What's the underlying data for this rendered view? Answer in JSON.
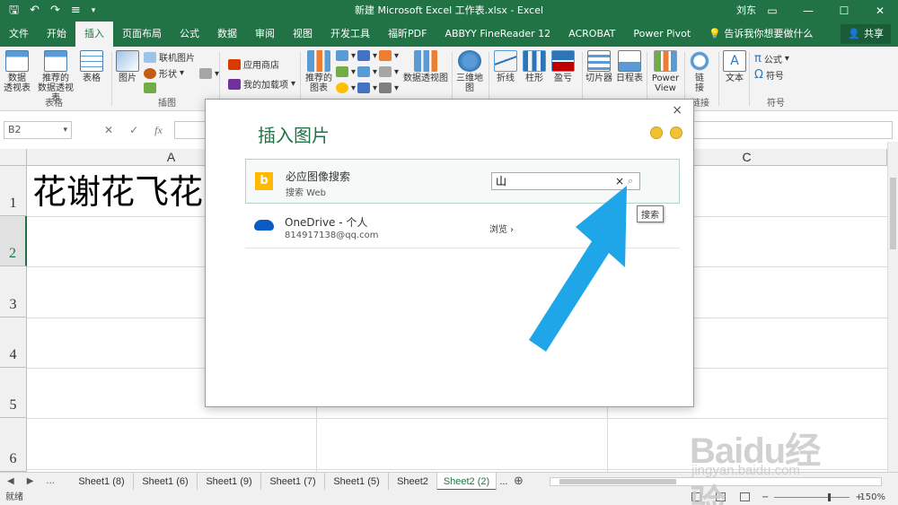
{
  "window": {
    "title": "新建 Microsoft Excel 工作表.xlsx  -  Excel",
    "user": "刘东",
    "qat_icons": [
      "save-icon",
      "undo-icon",
      "redo-icon",
      "customize-icon"
    ]
  },
  "tabs": [
    "文件",
    "开始",
    "插入",
    "页面布局",
    "公式",
    "数据",
    "审阅",
    "视图",
    "开发工具",
    "福昕PDF",
    "ABBYY FineReader 12",
    "ACROBAT",
    "Power Pivot",
    "告诉我你想要做什么"
  ],
  "active_tab": "插入",
  "share": "共享",
  "ribbon": {
    "pivot": "数据\n透视表",
    "recommended_pivot": "推荐的\n数据透视表",
    "table": "表格",
    "group_tables": "表格",
    "picture": "图片",
    "online_picture": "联机图片",
    "shapes": "形状",
    "group_illustrations": "插图",
    "store": "应用商店",
    "my_addins": "我的加载项",
    "recommended_charts": "推荐的\n图表",
    "pivot_chart": "数据透视图",
    "map3d": "三维地\n图",
    "line": "折线",
    "column": "柱形",
    "winloss": "盈亏",
    "slicer": "切片器",
    "timeline": "日程表",
    "powerview": "Power\nView",
    "link": "链\n接",
    "group_links": "链接",
    "text": "文本",
    "equation": "公式",
    "symbol": "符号",
    "group_symbols": "符号"
  },
  "formula_bar": {
    "name_box": "B2",
    "cancel": "✕",
    "enter": "✓",
    "fx": "fx"
  },
  "grid": {
    "columns": [
      "A",
      "C"
    ],
    "rows": [
      "1",
      "2",
      "3",
      "4",
      "5",
      "6"
    ],
    "selected_row": "2",
    "cell_a1": "花谢花飞花"
  },
  "sheets": {
    "nav": [
      "◀",
      "▶",
      "..."
    ],
    "tabs": [
      "Sheet1 (8)",
      "Sheet1 (6)",
      "Sheet1 (9)",
      "Sheet1 (7)",
      "Sheet1 (5)",
      "Sheet2",
      "Sheet2 (2)"
    ],
    "active": "Sheet2 (2)",
    "more": "...",
    "add": "⊕"
  },
  "status": {
    "ready": "就绪",
    "zoom": "150%",
    "zoom_minus": "−",
    "zoom_plus": "+"
  },
  "dialog": {
    "title": "插入图片",
    "close": "×",
    "bing": {
      "name": "必应图像搜索",
      "sub": "搜索 Web",
      "query": "山",
      "clear": "×",
      "search_tooltip": "搜索"
    },
    "onedrive": {
      "name": "OneDrive - 个人",
      "account": "814917138@qq.com",
      "browse": "浏览 ›"
    }
  },
  "watermark": {
    "brand": "Baidu经验",
    "url": "jingyan.baidu.com"
  },
  "colors": {
    "excel_green": "#217346",
    "arrow_blue": "#1ea6e8",
    "bing_yellow": "#ffb900",
    "onedrive_blue": "#0a5bc4"
  }
}
